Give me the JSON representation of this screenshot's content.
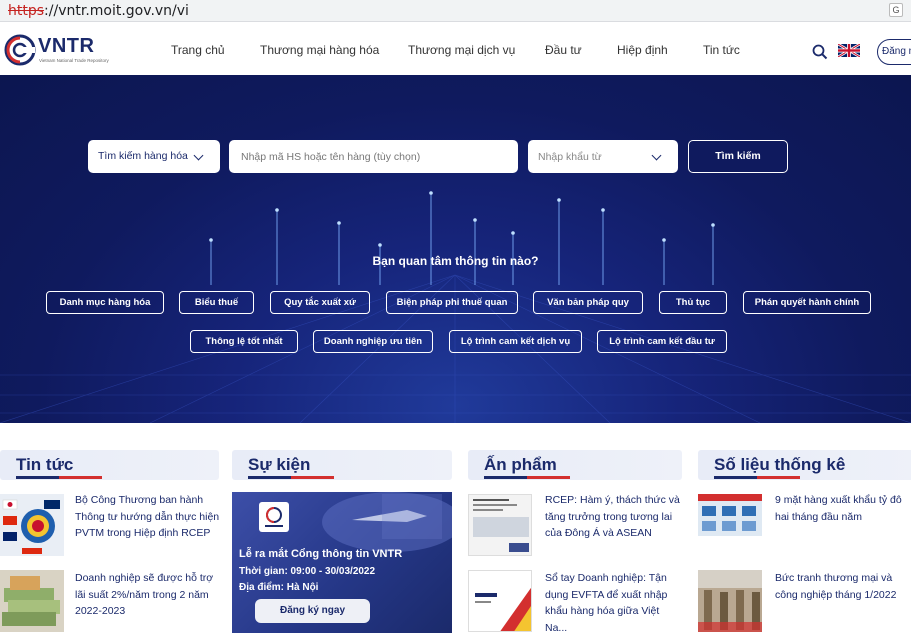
{
  "browser": {
    "url_protocol": "https",
    "url_rest": "://vntr.moit.gov.vn/vi",
    "translate_icon": "translate-icon"
  },
  "header": {
    "logo_text": "VNTR",
    "logo_subtitle": "Vietnam National Trade Repository",
    "nav": [
      "Trang chủ",
      "Thương mại hàng hóa",
      "Thương mại dịch vụ",
      "Đầu tư",
      "Hiệp định",
      "Tin tức"
    ],
    "login_label": "Đăng n",
    "icons": {
      "search": "search-icon",
      "language": "uk-flag-icon"
    }
  },
  "hero": {
    "type_select": "Tìm kiếm hàng hóa",
    "search_placeholder": "Nhập mã HS hoặc tên hàng (tùy chọn)",
    "market_select": "Nhập khẩu từ",
    "search_button": "Tìm kiếm",
    "question": "Bạn quan tâm thông tin nào?",
    "row1": [
      "Danh mục hàng hóa",
      "Biểu thuế",
      "Quy tắc xuất xứ",
      "Biện pháp phi thuế quan",
      "Văn bản pháp quy",
      "Thủ tục",
      "Phán quyết hành chính"
    ],
    "row2": [
      "Thông lệ tốt nhất",
      "Doanh nghiệp ưu tiên",
      "Lộ trình cam kết dịch vụ",
      "Lộ trình cam kết đầu tư"
    ]
  },
  "sections": {
    "news": {
      "title": "Tin tức",
      "items": [
        "Bộ Công Thương ban hành Thông tư hướng dẫn thực hiện PVTM trong Hiệp định RCEP",
        "Doanh nghiệp sẽ được hỗ trợ lãi suất 2%/năm trong 2 năm 2022-2023"
      ]
    },
    "events": {
      "title": "Sự kiện",
      "event_title": "Lễ ra mắt Cổng thông tin VNTR",
      "event_time": "Thời gian: 09:00 - 30/03/2022",
      "event_place": "Địa điểm: Hà Nội",
      "register_button": "Đăng ký ngay"
    },
    "publications": {
      "title": "Ấn phẩm",
      "items": [
        "RCEP: Hàm ý, thách thức và tăng trưởng trong tương lai của Đông Á và ASEAN",
        "Sổ tay Doanh nghiệp: Tận dụng EVFTA để xuất nhập khẩu hàng hóa giữa Việt Na..."
      ]
    },
    "statistics": {
      "title": "Số liệu thống kê",
      "items": [
        "9 mặt hàng xuất khẩu tỷ đô hai tháng đầu năm",
        "Bức tranh thương mại và công nghiệp tháng 1/2022"
      ]
    }
  },
  "colors": {
    "brand": "#1b2a6b",
    "accent": "#d32f2f",
    "hero_bg": "#0f1a5e"
  }
}
